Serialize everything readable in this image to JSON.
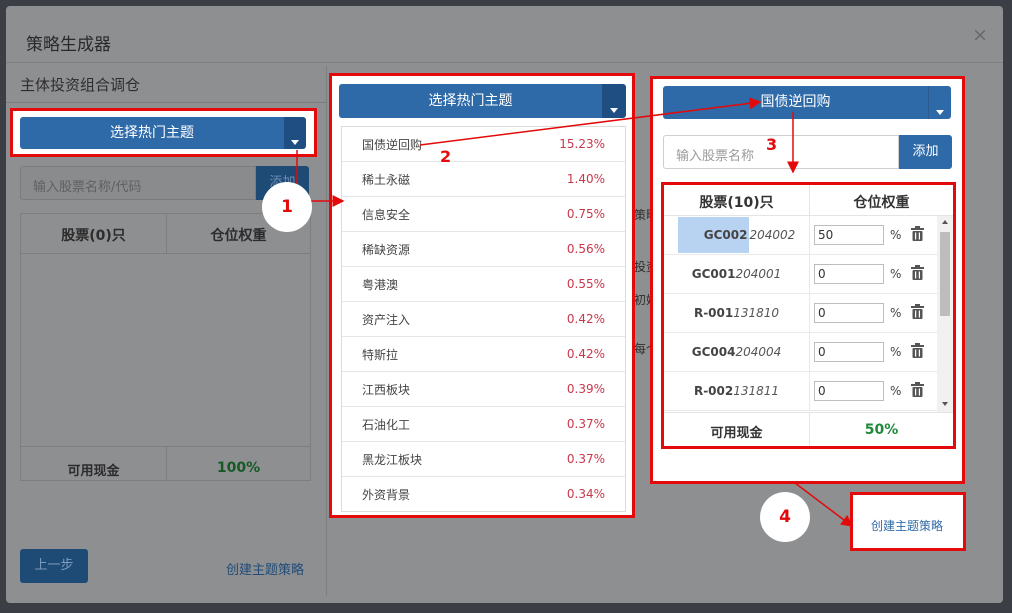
{
  "modal": {
    "title": "策略生成器",
    "close": "×"
  },
  "left_panel": {
    "title": "主体投资组合调仓",
    "select_button": "选择热门主题",
    "search_placeholder": "输入股票名称/代码",
    "add_button": "添加",
    "table_header": {
      "stocks": "股票(0)只",
      "weight": "仓位权重"
    },
    "cash_label": "可用现金",
    "cash_value": "100%",
    "prev_button": "上一步",
    "create_link": "创建主题策略"
  },
  "dropdown_panel": {
    "select_button": "选择热门主题",
    "items": [
      {
        "name": "国债逆回购",
        "pct": "15.23%"
      },
      {
        "name": "稀土永磁",
        "pct": "1.40%"
      },
      {
        "name": "信息安全",
        "pct": "0.75%"
      },
      {
        "name": "稀缺资源",
        "pct": "0.56%"
      },
      {
        "name": "粤港澳",
        "pct": "0.55%"
      },
      {
        "name": "资产注入",
        "pct": "0.42%"
      },
      {
        "name": "特斯拉",
        "pct": "0.42%"
      },
      {
        "name": "江西板块",
        "pct": "0.39%"
      },
      {
        "name": "石油化工",
        "pct": "0.37%"
      },
      {
        "name": "黑龙江板块",
        "pct": "0.37%"
      },
      {
        "name": "外资背景",
        "pct": "0.34%"
      }
    ]
  },
  "background_snippets": [
    "策略",
    "投资",
    "初始",
    "每个"
  ],
  "right_panel": {
    "select_button": "国债逆回购",
    "search_placeholder": "输入股票名称",
    "add_button": "添加",
    "table_header": {
      "stocks": "股票(10)只",
      "weight": "仓位权重"
    },
    "rows": [
      {
        "name": "GC002",
        "code": "204002",
        "weight": "50",
        "unit": "%"
      },
      {
        "name": "GC001",
        "code": "204001",
        "weight": "0",
        "unit": "%"
      },
      {
        "name": "R-001",
        "code": "131810",
        "weight": "0",
        "unit": "%"
      },
      {
        "name": "GC004",
        "code": "204004",
        "weight": "0",
        "unit": "%"
      },
      {
        "name": "R-002",
        "code": "131811",
        "weight": "0",
        "unit": "%"
      }
    ],
    "cash_label": "可用现金",
    "cash_value": "50%",
    "create_link": "创建主题策略"
  },
  "annotations": {
    "n1": "1",
    "n2": "2",
    "n3": "3",
    "n4": "4"
  },
  "colors": {
    "primary_blue": "#2f6aa8",
    "highlight_red": "#e20a0a",
    "pct_red": "#c9374b",
    "cash_green": "#1f8a3a"
  }
}
